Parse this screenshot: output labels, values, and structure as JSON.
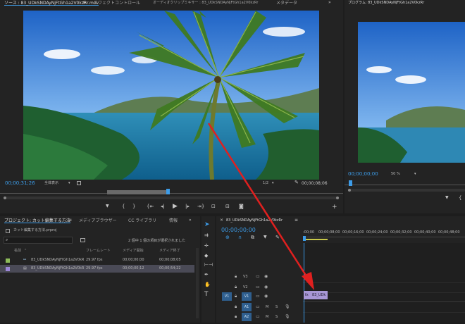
{
  "source_panel": {
    "tab_source": "ソース : 83_UDkSNDAyNjFtGh1a2V0kzRr.mov",
    "tab_effect_controls": "エフェクトコントロール",
    "tab_audio_mixer": "オーディオクリップミキサー : 83_UDkSNDAyNjFtGh1a2V0kzRr",
    "tab_metadata": "メタデータ",
    "timecode_current": "00;00;31;26",
    "fit_label": "全体表示",
    "resolution": "1/2",
    "timecode_duration": "00;00;08;06"
  },
  "program_panel": {
    "tab_label": "プログラム: 83_UDkSNDAyNjFtGh1a2V0kzRr",
    "timecode": "00;00;00;00",
    "zoom": "50 %"
  },
  "project_panel": {
    "tab_project": "プロジェクト: カット編集する方法",
    "tab_media_browser": "メディアブラウザー",
    "tab_library": "CC ライブラリ",
    "tab_info": "情報",
    "project_file": "カット編集する方法.prproj",
    "search_placeholder": "",
    "selection_status": "2 個中 1 個の項目が選択されました",
    "columns": {
      "name": "名前",
      "framerate": "フレームレート",
      "media_start": "メディア開始",
      "media_end": "メディア終了"
    },
    "items": [
      {
        "name": "83_UDkSNDAyNjFtGh1a2V0kR",
        "framerate": "29.97 fps",
        "start": "00;00;00;00",
        "end": "00;00;08;05"
      },
      {
        "name": "83_UDkSNDAyNjFtGh1a2V0kR",
        "framerate": "29.97 fps",
        "start": "00;00;00;12",
        "end": "00;00;54;22"
      }
    ]
  },
  "timeline": {
    "tab_label": "83_UDkSNDAyNjFtGh1a2V0kzRr",
    "timecode": "00;00;00;00",
    "ruler": [
      ":00;00",
      "00;00;08;00",
      "00;00;16;00",
      "00;00;24;00",
      "00;00;32;00",
      "00;00;40;00",
      "00;00;48;00"
    ],
    "video_tracks": [
      {
        "label": "V3",
        "target": ""
      },
      {
        "label": "V2",
        "target": ""
      },
      {
        "label": "V1",
        "target": "V1"
      }
    ],
    "audio_tracks": [
      {
        "label": "A1",
        "mute": "M",
        "solo": "S"
      },
      {
        "label": "A2",
        "mute": "M",
        "solo": "S"
      }
    ],
    "clip_label": "83_UDk",
    "clip_color": "#a897d6"
  },
  "colors": {
    "accent": "#3d9ce8",
    "annotation_arrow": "#e0201f",
    "panel_bg": "#232323"
  }
}
